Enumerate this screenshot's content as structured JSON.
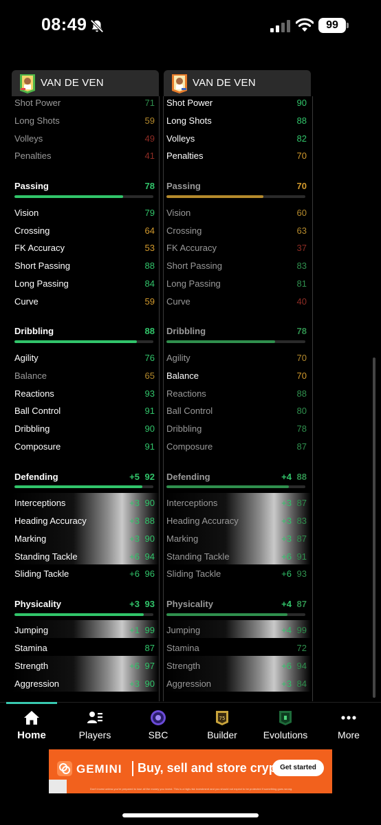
{
  "status_bar": {
    "time": "08:49",
    "battery": "99"
  },
  "colors": {
    "accent_green": "#31c46a",
    "accent_orange": "#d39a2c",
    "accent_red": "#c0392b",
    "nav_indicator": "#38c9b0",
    "ad_background": "#f2611d"
  },
  "left_card": {
    "name": "VAN DE VEN",
    "shooting_rows": [
      {
        "label": "Shot Power",
        "value": "71"
      },
      {
        "label": "Long Shots",
        "value": "59"
      },
      {
        "label": "Volleys",
        "value": "49"
      },
      {
        "label": "Penalties",
        "value": "41"
      }
    ],
    "passing": {
      "label": "Passing",
      "value": "78",
      "fill": 0.78
    },
    "passing_rows": [
      {
        "label": "Vision",
        "value": "79"
      },
      {
        "label": "Crossing",
        "value": "64"
      },
      {
        "label": "FK Accuracy",
        "value": "53"
      },
      {
        "label": "Short Passing",
        "value": "88"
      },
      {
        "label": "Long Passing",
        "value": "84"
      },
      {
        "label": "Curve",
        "value": "59"
      }
    ],
    "dribbling": {
      "label": "Dribbling",
      "value": "88",
      "fill": 0.88
    },
    "dribbling_rows": [
      {
        "label": "Agility",
        "value": "76"
      },
      {
        "label": "Balance",
        "value": "65"
      },
      {
        "label": "Reactions",
        "value": "93"
      },
      {
        "label": "Ball Control",
        "value": "91"
      },
      {
        "label": "Dribbling",
        "value": "90"
      },
      {
        "label": "Composure",
        "value": "91"
      }
    ],
    "defending": {
      "label": "Defending",
      "bonus": "+5",
      "value": "92",
      "fill": 0.92
    },
    "defending_rows": [
      {
        "label": "Interceptions",
        "bonus": "+3",
        "value": "90"
      },
      {
        "label": "Heading Accuracy",
        "bonus": "+3",
        "value": "88"
      },
      {
        "label": "Marking",
        "bonus": "+3",
        "value": "90"
      },
      {
        "label": "Standing Tackle",
        "bonus": "+6",
        "value": "94"
      },
      {
        "label": "Sliding Tackle",
        "bonus": "+6",
        "value": "96"
      }
    ],
    "physicality": {
      "label": "Physicality",
      "bonus": "+3",
      "value": "93",
      "fill": 0.93
    },
    "physicality_rows": [
      {
        "label": "Jumping",
        "bonus": "+1",
        "value": "99"
      },
      {
        "label": "Stamina",
        "bonus": "",
        "value": "87"
      },
      {
        "label": "Strength",
        "bonus": "+6",
        "value": "97"
      },
      {
        "label": "Aggression",
        "bonus": "+3",
        "value": "90"
      }
    ]
  },
  "right_card": {
    "name": "VAN DE VEN",
    "shooting_rows": [
      {
        "label": "Shot Power",
        "value": "90"
      },
      {
        "label": "Long Shots",
        "value": "88"
      },
      {
        "label": "Volleys",
        "value": "82"
      },
      {
        "label": "Penalties",
        "value": "70"
      }
    ],
    "passing": {
      "label": "Passing",
      "value": "70",
      "fill": 0.7
    },
    "passing_rows": [
      {
        "label": "Vision",
        "value": "60"
      },
      {
        "label": "Crossing",
        "value": "63"
      },
      {
        "label": "FK Accuracy",
        "value": "37"
      },
      {
        "label": "Short Passing",
        "value": "83"
      },
      {
        "label": "Long Passing",
        "value": "81"
      },
      {
        "label": "Curve",
        "value": "40"
      }
    ],
    "dribbling": {
      "label": "Dribbling",
      "value": "78",
      "fill": 0.78
    },
    "dribbling_rows": [
      {
        "label": "Agility",
        "value": "70"
      },
      {
        "label": "Balance",
        "value": "70"
      },
      {
        "label": "Reactions",
        "value": "88"
      },
      {
        "label": "Ball Control",
        "value": "80"
      },
      {
        "label": "Dribbling",
        "value": "78"
      },
      {
        "label": "Composure",
        "value": "87"
      }
    ],
    "defending": {
      "label": "Defending",
      "bonus": "+4",
      "value": "88",
      "fill": 0.88
    },
    "defending_rows": [
      {
        "label": "Interceptions",
        "bonus": "+3",
        "value": "87"
      },
      {
        "label": "Heading Accuracy",
        "bonus": "+3",
        "value": "83"
      },
      {
        "label": "Marking",
        "bonus": "+3",
        "value": "87"
      },
      {
        "label": "Standing Tackle",
        "bonus": "+6",
        "value": "91"
      },
      {
        "label": "Sliding Tackle",
        "bonus": "+6",
        "value": "93"
      }
    ],
    "physicality": {
      "label": "Physicality",
      "bonus": "+4",
      "value": "87",
      "fill": 0.87
    },
    "physicality_rows": [
      {
        "label": "Jumping",
        "bonus": "+4",
        "value": "99"
      },
      {
        "label": "Stamina",
        "bonus": "",
        "value": "72"
      },
      {
        "label": "Strength",
        "bonus": "+6",
        "value": "94"
      },
      {
        "label": "Aggression",
        "bonus": "+3",
        "value": "84"
      }
    ]
  },
  "nav": {
    "items": [
      {
        "label": "Home",
        "icon": "home-icon"
      },
      {
        "label": "Players",
        "icon": "players-icon"
      },
      {
        "label": "SBC",
        "icon": "sbc-icon"
      },
      {
        "label": "Builder",
        "icon": "builder-icon"
      },
      {
        "label": "Evolutions",
        "icon": "evolutions-icon"
      },
      {
        "label": "More",
        "icon": "more-icon"
      }
    ]
  },
  "ad": {
    "brand": "GEMINI",
    "tagline": "Buy, sell and store crypto",
    "cta": "Get started",
    "disclaimer": "Don't invest unless you're prepared to lose all the money you invest. This is a high-risk investment and you should not expect to be protected if something goes wrong."
  }
}
